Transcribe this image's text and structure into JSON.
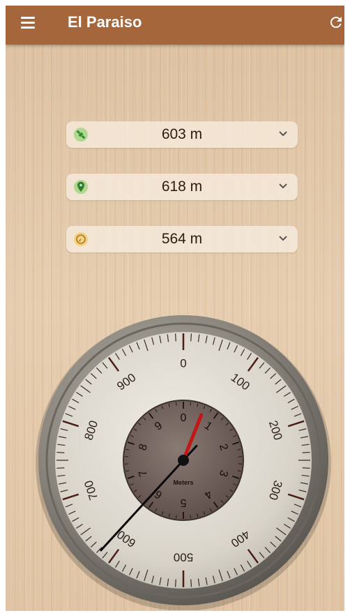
{
  "header": {
    "title": "El Paraiso",
    "menu_icon": "hamburger-menu-icon",
    "refresh_icon": "refresh-icon",
    "bg_color": "#a4663a"
  },
  "readings": [
    {
      "icon": "satellite-icon",
      "value": "603 m",
      "icon_color": "#4caf50"
    },
    {
      "icon": "location-pin-icon",
      "value": "618 m",
      "icon_color": "#3f9d3f"
    },
    {
      "icon": "barometer-icon",
      "value": "564 m",
      "icon_color": "#e0a020"
    }
  ],
  "gauge": {
    "outer_labels": [
      "0",
      "100",
      "200",
      "300",
      "400",
      "500",
      "600",
      "700",
      "800",
      "900"
    ],
    "inner_labels": [
      "0",
      "1",
      "2",
      "3",
      "4",
      "5",
      "6",
      "7",
      "8",
      "9"
    ],
    "unit": "Meters",
    "long_hand_value": 618,
    "short_hand_value": 0.6
  }
}
